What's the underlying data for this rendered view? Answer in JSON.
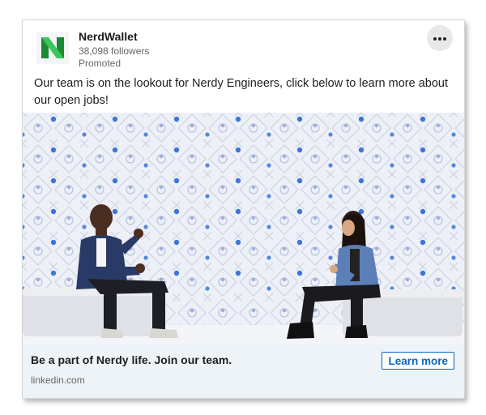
{
  "post": {
    "company_name": "NerdWallet",
    "followers": "38,098 followers",
    "promoted_label": "Promoted",
    "text": "Our team is on the lookout for Nerdy Engineers, click below to learn more about our open jobs!",
    "logo_icon": "nerdwallet-logo-icon",
    "more_icon": "more-options-icon"
  },
  "image": {
    "description_icon": "promo-photo-icon"
  },
  "cta": {
    "headline": "Be a part of Nerdy life. Join our team.",
    "domain": "linkedin.com",
    "button_label": "Learn more"
  },
  "colors": {
    "brand_green": "#1fa33f",
    "link_blue": "#0a66c2",
    "footer_bg": "#eef3f8"
  }
}
